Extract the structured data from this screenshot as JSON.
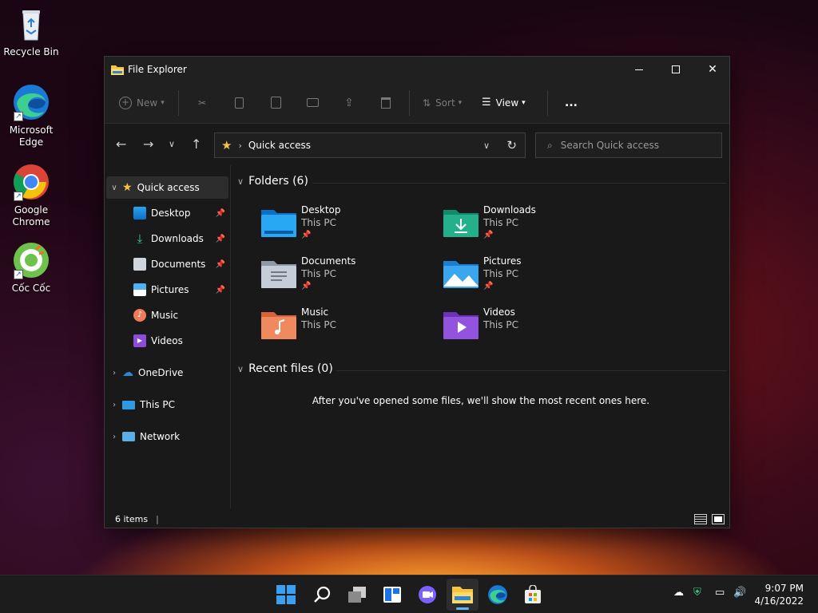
{
  "desktop": {
    "icons": [
      {
        "label": "Recycle Bin"
      },
      {
        "label": "Microsoft Edge"
      },
      {
        "label": "Google Chrome"
      },
      {
        "label": "Cốc Cốc"
      }
    ]
  },
  "window": {
    "title": "File Explorer",
    "toolbar": {
      "new_label": "New",
      "sort_label": "Sort",
      "view_label": "View",
      "more_label": "..."
    },
    "address": {
      "current": "Quick access"
    },
    "search": {
      "placeholder": "Search Quick access"
    },
    "nav": {
      "quick_access": "Quick access",
      "pinned": [
        {
          "label": "Desktop"
        },
        {
          "label": "Downloads"
        },
        {
          "label": "Documents"
        },
        {
          "label": "Pictures"
        }
      ],
      "others": [
        {
          "label": "Music"
        },
        {
          "label": "Videos"
        }
      ],
      "onedrive": "OneDrive",
      "thispc": "This PC",
      "network": "Network"
    },
    "folders_header": "Folders (6)",
    "folders": [
      {
        "name": "Desktop",
        "location": "This PC"
      },
      {
        "name": "Downloads",
        "location": "This PC"
      },
      {
        "name": "Documents",
        "location": "This PC"
      },
      {
        "name": "Pictures",
        "location": "This PC"
      },
      {
        "name": "Music",
        "location": "This PC"
      },
      {
        "name": "Videos",
        "location": "This PC"
      }
    ],
    "recent_header": "Recent files (0)",
    "recent_empty": "After you've opened some files, we'll show the most recent ones here.",
    "status": "6 items"
  },
  "taskbar": {
    "clock_time": "9:07 PM",
    "clock_date": "4/16/2022"
  },
  "colors": {
    "accent": "#0078d4",
    "folder_yellow": "#f6c443",
    "window_bg": "#191919"
  }
}
